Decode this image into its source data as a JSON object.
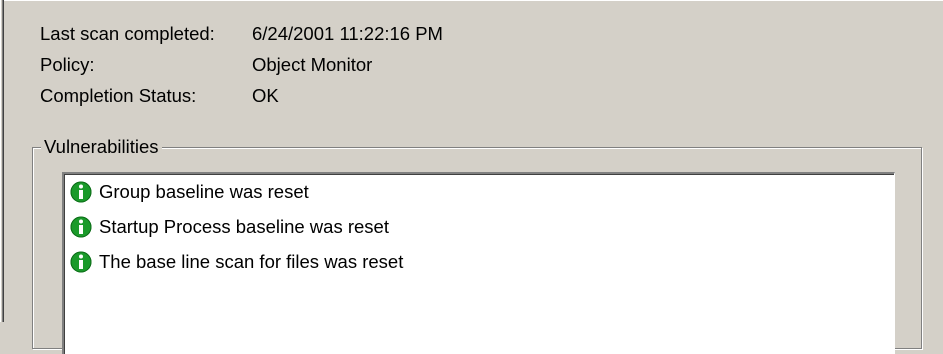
{
  "scan_info": {
    "last_scan_label": "Last scan completed:",
    "last_scan_value": "6/24/2001 11:22:16 PM",
    "policy_label": "Policy:",
    "policy_value": "Object Monitor",
    "status_label": "Completion Status:",
    "status_value": "OK"
  },
  "vulnerabilities": {
    "title": "Vulnerabilities",
    "items": [
      {
        "icon": "info-icon",
        "text": "Group baseline was reset"
      },
      {
        "icon": "info-icon",
        "text": "Startup Process baseline was reset"
      },
      {
        "icon": "info-icon",
        "text": "The base line scan for files was reset"
      }
    ]
  },
  "colors": {
    "dialog_bg": "#d4d0c8",
    "icon_green": "#1a9a2a",
    "list_bg": "#ffffff"
  }
}
